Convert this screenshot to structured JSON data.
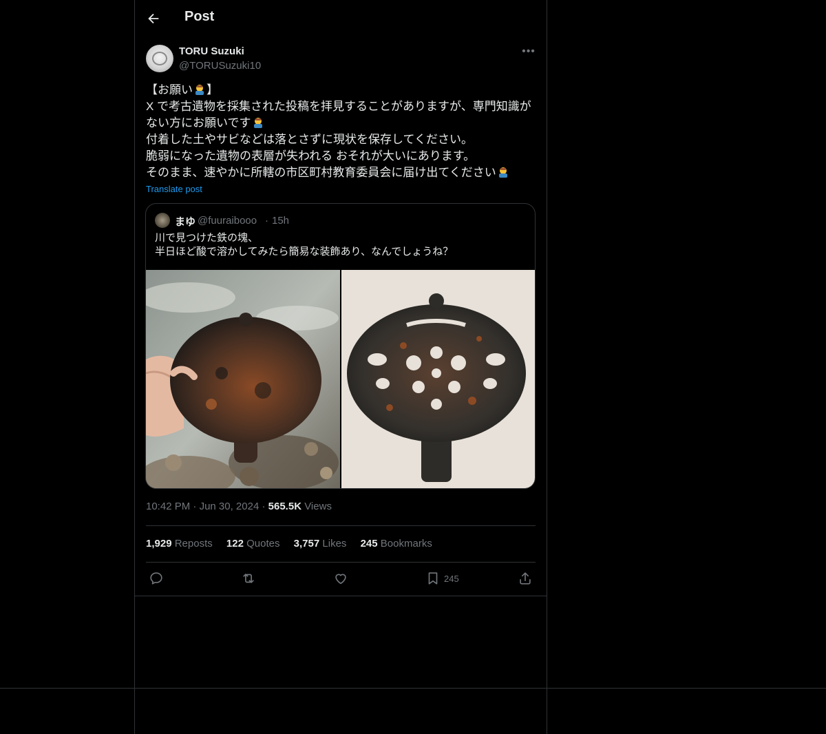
{
  "header": {
    "title": "Post"
  },
  "author": {
    "display_name": "TORU Suzuki",
    "handle": "@TORUSuzuki10"
  },
  "post": {
    "lines": [
      "【お願い",
      "】",
      "X で考古遺物を採集された投稿を拝見することがありますが、専門知識が",
      "ない方にお願いです",
      " 付着した土やサビなどは落とさずに現状を保存してください。",
      " 脆弱になった遺物の表層が失われる おそれが大いにあります。",
      " そのまま、速やかに所轄の市区町村教育委員会に届け出てください"
    ],
    "emoji": "person-bowing-emoji",
    "translate_label": "Translate post"
  },
  "quote": {
    "name": "まゆ",
    "handle": "@fuuraibooo",
    "dot": "·",
    "time": "15h",
    "lines": [
      "川で見つけた鉄の塊、",
      "半日ほど酸で溶かしてみたら簡易な装飾あり、なんでしょうね？"
    ]
  },
  "meta": {
    "time": "10:42 PM",
    "sep": "·",
    "date": "Jun 30, 2024",
    "views_count": "565.5K",
    "views_label": "Views"
  },
  "stats": {
    "reposts_count": "1,929",
    "reposts_label": "Reposts",
    "quotes_count": "122",
    "quotes_label": "Quotes",
    "likes_count": "3,757",
    "likes_label": "Likes",
    "bookmarks_count": "245",
    "bookmarks_label": "Bookmarks"
  },
  "actions": {
    "bookmark_count": "245"
  },
  "icons": [
    "back-arrow-icon",
    "more-icon",
    "reply-icon",
    "repost-icon",
    "like-icon",
    "bookmark-icon",
    "share-icon"
  ],
  "colors": {
    "background": "#000000",
    "text": "#e7e9ea",
    "muted": "#71767b",
    "link": "#1d9bf0",
    "border": "#2f3336"
  }
}
